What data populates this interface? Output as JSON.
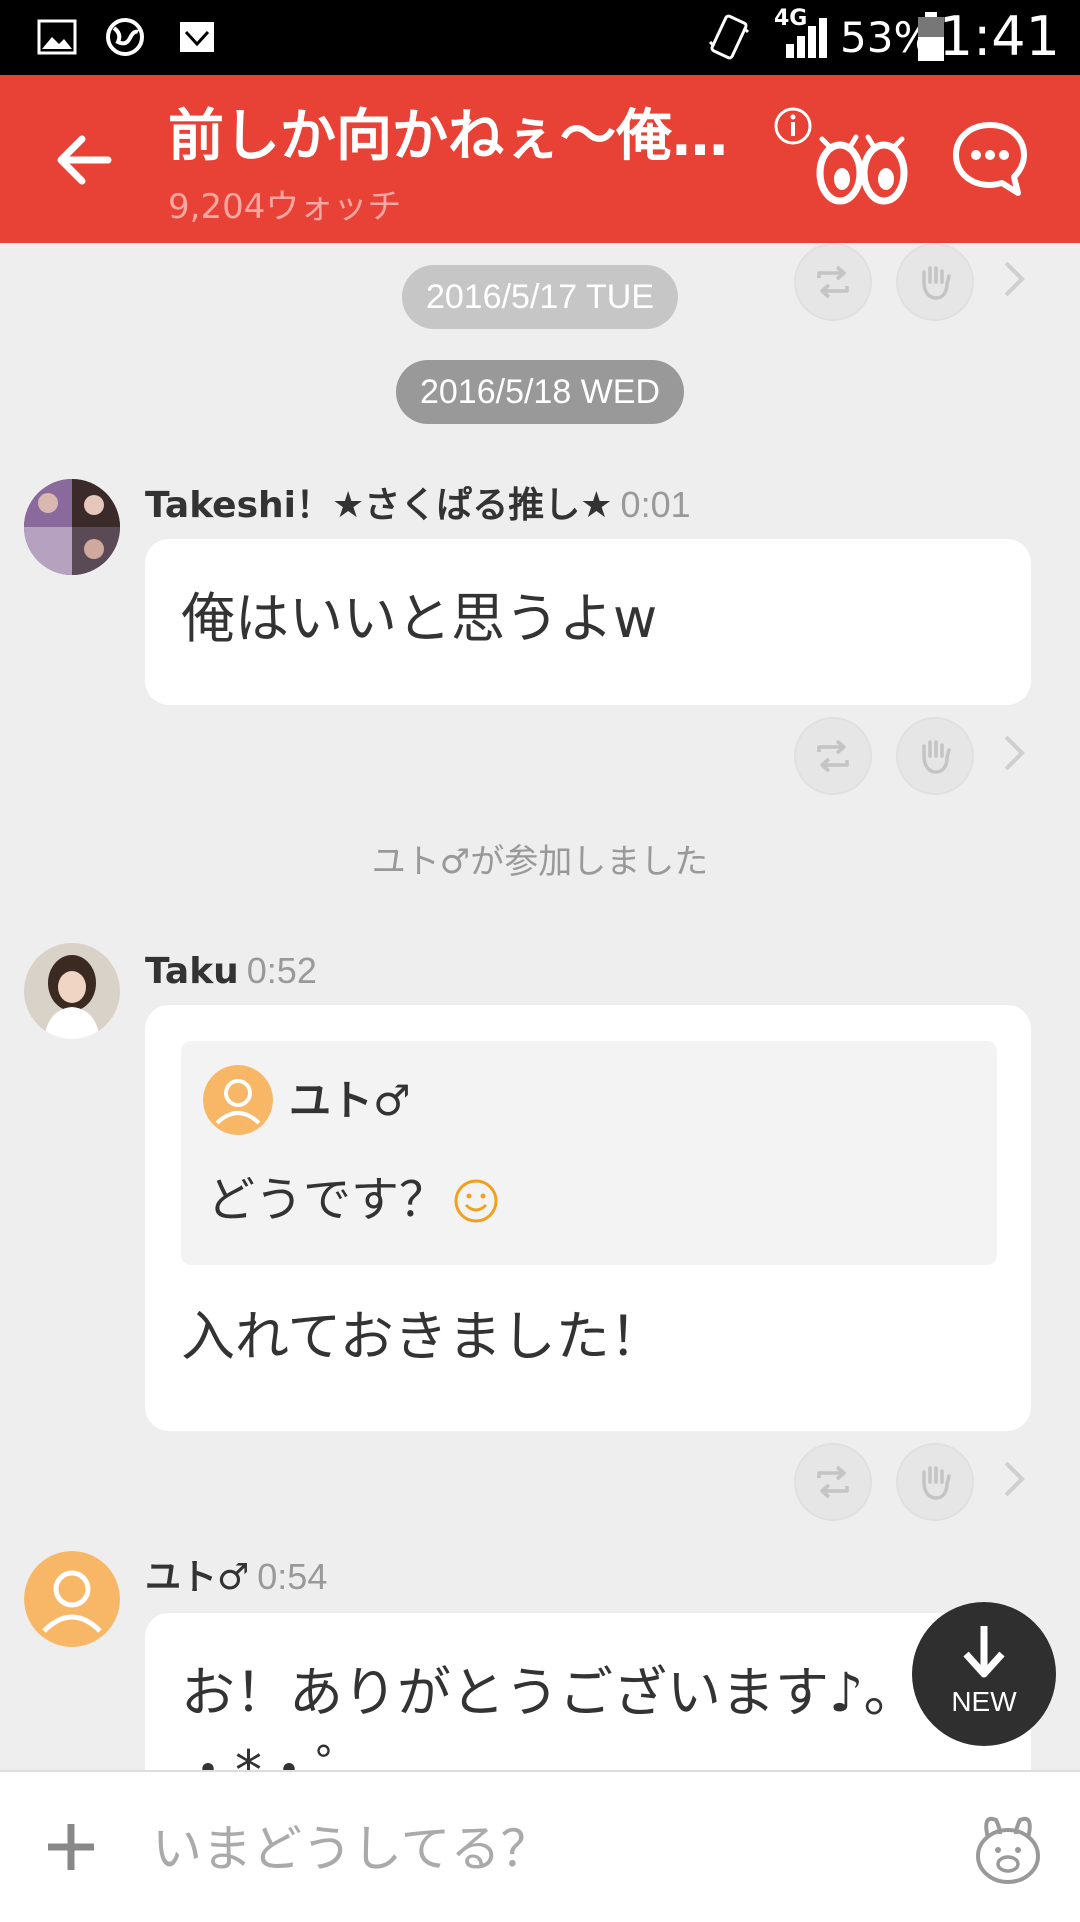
{
  "status_bar": {
    "network": "4G",
    "battery": "53%",
    "time": "1:41",
    "icons": [
      "image-icon",
      "globe-icon",
      "mail-icon",
      "vibrate-icon",
      "signal-icon",
      "battery-icon"
    ]
  },
  "header": {
    "title": "前しか向かねぇ〜俺…",
    "watch_count": "9,204ウォッチ",
    "accent_color": "#e84237"
  },
  "timeline": {
    "date_1": "2016/5/17 TUE",
    "date_2": "2016/5/18 WED",
    "system_join": "ユト♂が参加しました",
    "messages": [
      {
        "author": "Takeshi！★さくぱる推し★",
        "time": "0:01",
        "text": "俺はいいと思うよw"
      },
      {
        "author": "Taku",
        "time": "0:52",
        "quote_author": "ユト♂",
        "quote_text": "どうです？",
        "text": "入れておきました！"
      },
      {
        "author": "ユト♂",
        "time": "0:54",
        "text": "お！ありがとうございます♪。",
        "text_line2": "・*・゜"
      }
    ]
  },
  "new_button": {
    "label": "NEW"
  },
  "composer": {
    "placeholder": "いまどうしてる？"
  }
}
